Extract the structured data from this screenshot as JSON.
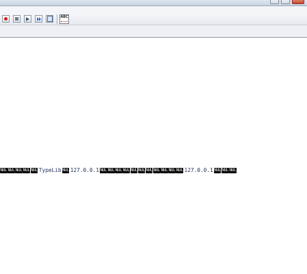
{
  "window": {
    "buttons": [
      "minimize",
      "maximize",
      "close"
    ]
  },
  "toolbar": {
    "buttons": [
      {
        "name": "record-button",
        "icon": "record-icon"
      },
      {
        "name": "stop-button",
        "icon": "stop-icon"
      },
      {
        "name": "play-button",
        "icon": "play-icon"
      },
      {
        "name": "fast-forward-button",
        "icon": "fast-forward-icon"
      },
      {
        "name": "save-button",
        "icon": "document-icon"
      },
      {
        "name": "spellcheck-button",
        "icon": "spellcheck-icon",
        "label": "ABC"
      }
    ]
  },
  "content": {
    "tokens": [
      {
        "t": "nul",
        "v": "NUL"
      },
      {
        "t": "nul",
        "v": "NUL"
      },
      {
        "t": "nul",
        "v": "NUL"
      },
      {
        "t": "nul",
        "v": "NUL"
      },
      {
        "t": "nul",
        "v": "NUL"
      },
      {
        "t": "txt",
        "v": "TypeLib"
      },
      {
        "t": "nul",
        "v": "NUL"
      },
      {
        "t": "txt",
        "v": "127.0.0.1"
      },
      {
        "t": "nul",
        "v": "NUL"
      },
      {
        "t": "nul",
        "v": "NUL"
      },
      {
        "t": "nul",
        "v": "NUL"
      },
      {
        "t": "nul",
        "v": "NUL"
      },
      {
        "t": "nul",
        "v": "NUL"
      },
      {
        "t": "nul",
        "v": "NUL"
      },
      {
        "t": "nul",
        "v": "NUL"
      },
      {
        "t": "nul",
        "v": "NUL"
      },
      {
        "t": "nul",
        "v": "NUL"
      },
      {
        "t": "nul",
        "v": "NUL"
      },
      {
        "t": "nul",
        "v": "NUL"
      },
      {
        "t": "txt",
        "v": "127.0.0.1"
      },
      {
        "t": "nul",
        "v": "NUL"
      },
      {
        "t": "nul",
        "v": "NUL"
      },
      {
        "t": "nul",
        "v": "NUL"
      }
    ]
  }
}
